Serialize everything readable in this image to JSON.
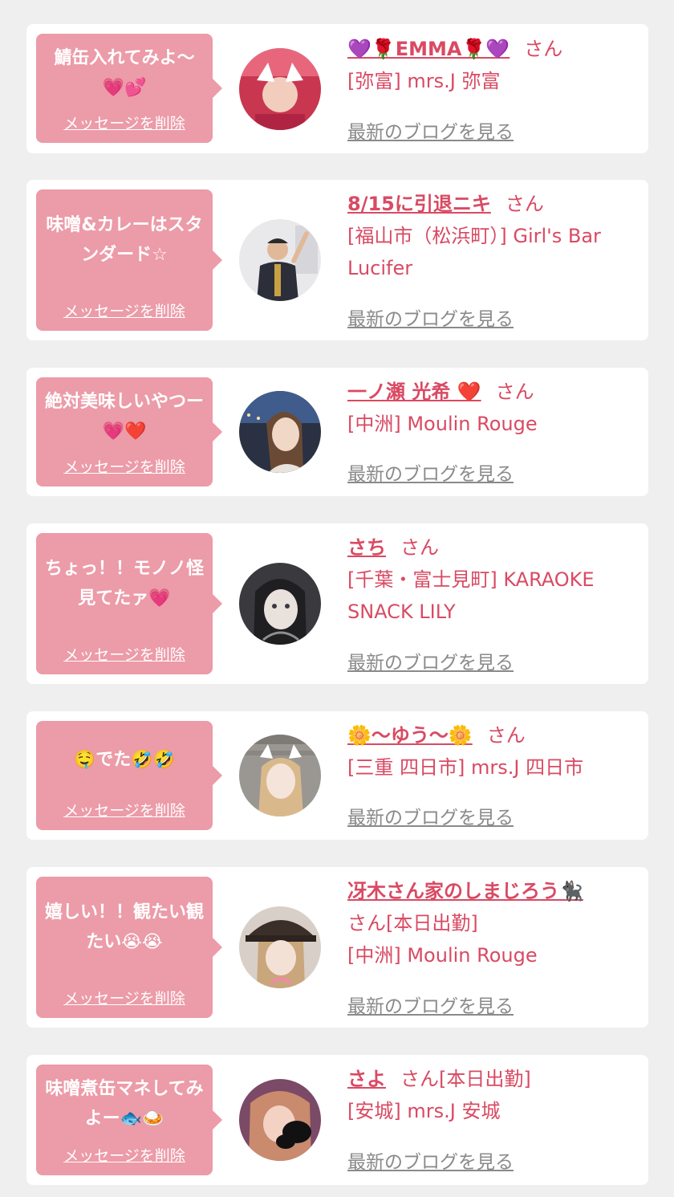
{
  "delete_label": "メッセージを削除",
  "san_label": "さん",
  "blog_label": "最新のブログを見る",
  "colors": {
    "page_bg": "#efefef",
    "card_bg": "#ffffff",
    "bubble": "#ec9ba8",
    "accent": "#d94a63",
    "link_gray": "#8a8a8a"
  },
  "items": [
    {
      "message": "鯖缶入れてみよ〜\n💗💕",
      "name": "💜🌹EMMA🌹💜",
      "suffix": "",
      "shop": "[弥富] mrs.J 弥富",
      "avatar": "avatar-photo"
    },
    {
      "message": "味噌&カレーはスタンダード☆",
      "name": "8/15に引退ニキ",
      "suffix": "",
      "shop": "[福山市（松浜町）] Girl's Bar Lucifer",
      "avatar": "avatar-photo"
    },
    {
      "message": "絶対美味しいやつー💗❤️",
      "name": "一ノ瀬 光希 ❤️",
      "suffix": "",
      "shop": "[中洲] Moulin Rouge",
      "avatar": "avatar-photo"
    },
    {
      "message": "ちょっ！！モノノ怪見てたァ💗",
      "name": "さち",
      "suffix": "",
      "shop": "[千葉・富士見町] KARAOKE SNACK LILY",
      "avatar": "avatar-photo"
    },
    {
      "message": "🤤でた🤣🤣",
      "name": "🌼〜ゆう〜🌼",
      "suffix": "",
      "shop": "[三重 四日市] mrs.J 四日市",
      "avatar": "avatar-photo"
    },
    {
      "message": "嬉しい！！観たい観たい😭😭",
      "name": "冴木さん家のしまじろう🐈‍⬛",
      "suffix": "[本日出勤]",
      "shop": "[中洲] Moulin Rouge",
      "avatar": "avatar-photo"
    },
    {
      "message": "味噌煮缶マネしてみよー🐟🍛",
      "name": "さよ",
      "suffix": "[本日出勤]",
      "shop": "[安城] mrs.J 安城",
      "avatar": "avatar-photo"
    }
  ]
}
